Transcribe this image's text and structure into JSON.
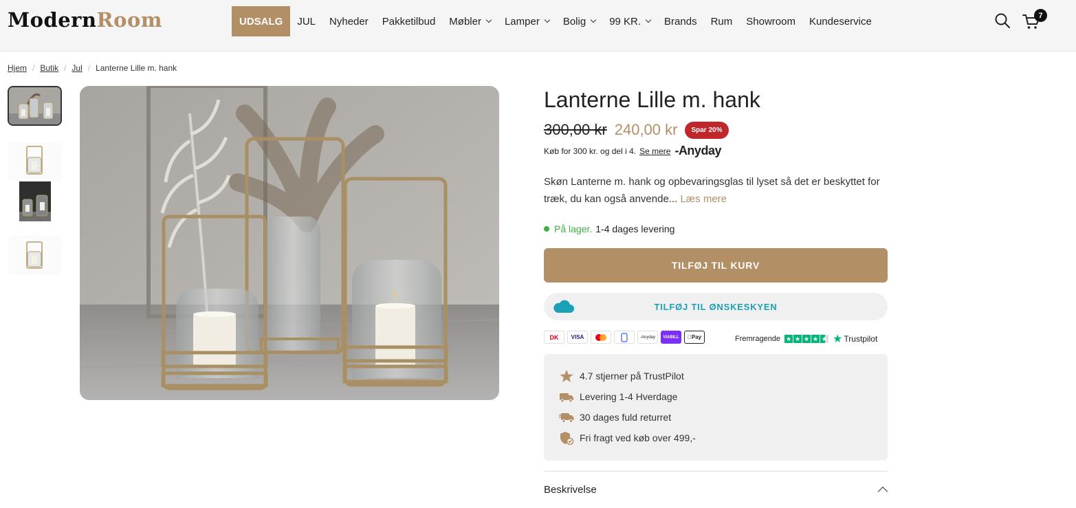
{
  "header": {
    "logo_part1": "Modern",
    "logo_part2": "Room",
    "nav": [
      {
        "label": "UDSALG",
        "has_dropdown": false,
        "highlight": true
      },
      {
        "label": "JUL",
        "has_dropdown": false
      },
      {
        "label": "Nyheder",
        "has_dropdown": false
      },
      {
        "label": "Pakketilbud",
        "has_dropdown": false
      },
      {
        "label": "Møbler",
        "has_dropdown": true
      },
      {
        "label": "Lamper",
        "has_dropdown": true
      },
      {
        "label": "Bolig",
        "has_dropdown": true
      },
      {
        "label": "99 KR.",
        "has_dropdown": true
      },
      {
        "label": "Brands",
        "has_dropdown": false
      },
      {
        "label": "Rum",
        "has_dropdown": false
      },
      {
        "label": "Showroom",
        "has_dropdown": false
      },
      {
        "label": "Kundeservice",
        "has_dropdown": false
      }
    ],
    "cart_count": "7"
  },
  "breadcrumb": [
    "Hjem",
    "Butik",
    "Jul",
    "Lanterne Lille m. hank"
  ],
  "product": {
    "title": "Lanterne Lille m. hank",
    "old_price": "300,00 kr",
    "new_price": "240,00 kr",
    "save_badge": "Spar 20%",
    "anyday_text": "Køb for 300 kr. og del i 4.",
    "anyday_more": "Se mere",
    "anyday_logo": "Anyday",
    "description": "Skøn Lanterne m. hank og opbevaringsglas til lyset så det er beskyttet for træk, du kan også anvende...",
    "read_more": "Læs mere",
    "stock_status": "På lager.",
    "stock_delivery": "1-4 dages levering",
    "add_to_cart": "TILFØJ TIL KURV",
    "wishlist": "TILFØJ TIL ØNSKESKYEN"
  },
  "payments": [
    "Dankort",
    "VISA",
    "Mastercard",
    "MobilePay",
    "Anyday",
    "ViaBill",
    "Apple Pay"
  ],
  "trustpilot": {
    "rating_word": "Fremragende",
    "brand": "Trustpilot",
    "stars": 4.5
  },
  "usps": [
    {
      "icon": "star-icon",
      "text": "4.7 stjerner på TrustPilot"
    },
    {
      "icon": "delivery-truck-icon",
      "text": "Levering 1-4 Hverdage"
    },
    {
      "icon": "return-truck-icon",
      "text": "30 dages fuld returret"
    },
    {
      "icon": "shield-check-icon",
      "text": "Fri fragt ved køb over 499,-"
    }
  ],
  "accordion": {
    "label": "Beskrivelse"
  },
  "colors": {
    "brand": "#b38f66",
    "sale_badge": "#c0272d",
    "wishlist": "#1aa1b7",
    "in_stock": "#3cb043"
  }
}
